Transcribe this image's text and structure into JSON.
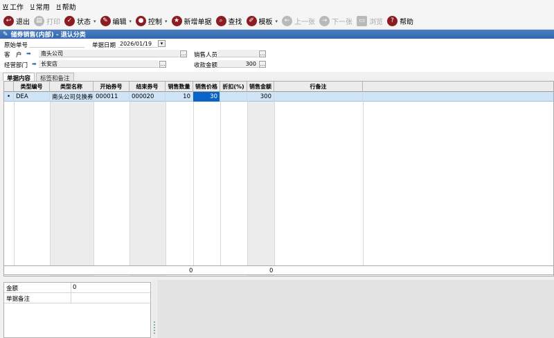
{
  "menu": [
    {
      "key": "W",
      "label": "工作"
    },
    {
      "key": "U",
      "label": "常用"
    },
    {
      "key": "H",
      "label": "帮助"
    }
  ],
  "toolbar": {
    "exit": "退出",
    "print": "打印",
    "status": "状态",
    "edit": "编辑",
    "control": "控制",
    "new_doc": "新增单据",
    "search": "查找",
    "template": "模板",
    "prev": "上一张",
    "next": "下一张",
    "browse": "浏览",
    "help": "帮助"
  },
  "title": "储券销售(内部) - 退认分类",
  "form": {
    "doc_no_label": "原始单号",
    "doc_no_value": "",
    "date_label": "单据日期",
    "date_value": "2026/01/19",
    "customer_label": "客　户",
    "customer_value": "南头公司",
    "salesperson_label": "销售人员",
    "salesperson_value": "",
    "dept_label": "经营部门",
    "dept_value": "长安店",
    "receipt_label": "收款金额",
    "receipt_value": "300"
  },
  "tabs": [
    "单据内容",
    "标签和备注"
  ],
  "grid": {
    "headers": [
      "类型编号",
      "类型名称",
      "开始券号",
      "结束券号",
      "销售数量",
      "销售价格",
      "折扣(%)",
      "销售金额",
      "行备注"
    ],
    "rows": [
      {
        "marker": "•",
        "type_code": "DEA",
        "type_name": "南头公司兑换券",
        "start_no": "000011",
        "end_no": "000020",
        "qty": "10",
        "price": "30",
        "discount": "",
        "amount": "300",
        "note": ""
      }
    ],
    "totals": {
      "qty": "0",
      "amount": "0"
    }
  },
  "bottom": {
    "amount_label": "金额",
    "amount_value": "0",
    "remark_label": "单据备注",
    "remark_value": ""
  }
}
